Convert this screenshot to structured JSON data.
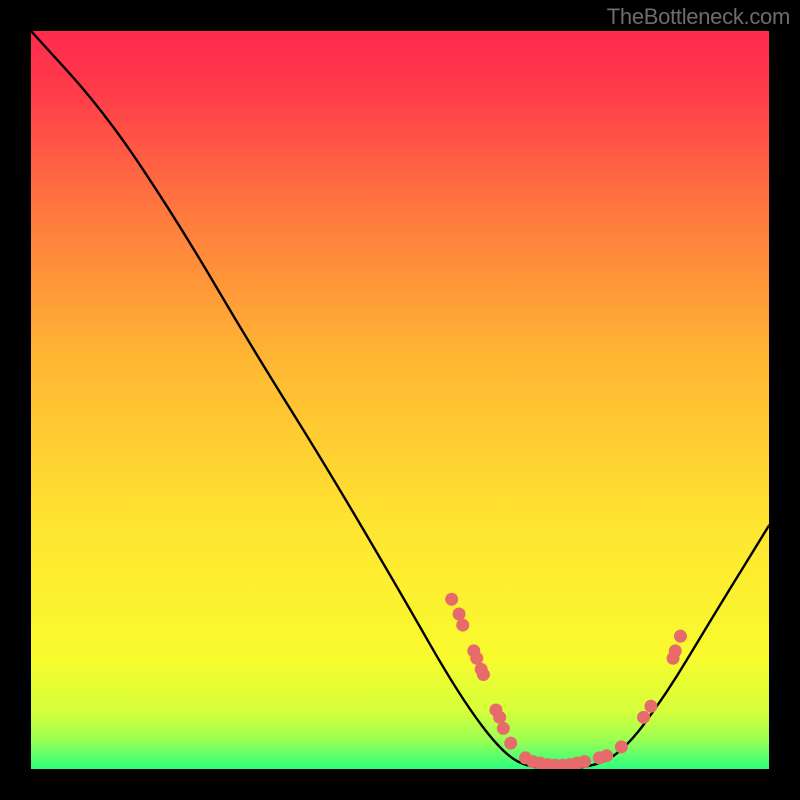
{
  "attribution": "TheBottleneck.com",
  "chart_data": {
    "type": "line",
    "title": "",
    "xlabel": "",
    "ylabel": "",
    "xlim": [
      0,
      100
    ],
    "ylim": [
      0,
      100
    ],
    "background": {
      "gradient_top": "#ff2a4d",
      "gradient_mid": "#ffe631",
      "gradient_bottom": "#2dff7e"
    },
    "curve": [
      {
        "x": 0,
        "y": 100
      },
      {
        "x": 10,
        "y": 89
      },
      {
        "x": 20,
        "y": 74
      },
      {
        "x": 30,
        "y": 57
      },
      {
        "x": 40,
        "y": 41
      },
      {
        "x": 50,
        "y": 24
      },
      {
        "x": 58,
        "y": 10
      },
      {
        "x": 64,
        "y": 2
      },
      {
        "x": 68,
        "y": 0
      },
      {
        "x": 75,
        "y": 0
      },
      {
        "x": 80,
        "y": 2
      },
      {
        "x": 86,
        "y": 10
      },
      {
        "x": 92,
        "y": 20
      },
      {
        "x": 100,
        "y": 33
      }
    ],
    "dots": [
      {
        "x": 57,
        "y": 23
      },
      {
        "x": 58,
        "y": 21
      },
      {
        "x": 58.5,
        "y": 19.5
      },
      {
        "x": 60,
        "y": 16
      },
      {
        "x": 60.4,
        "y": 15
      },
      {
        "x": 61,
        "y": 13.5
      },
      {
        "x": 61.3,
        "y": 12.8
      },
      {
        "x": 63,
        "y": 8
      },
      {
        "x": 63.5,
        "y": 7
      },
      {
        "x": 64,
        "y": 5.5
      },
      {
        "x": 65,
        "y": 3.5
      },
      {
        "x": 67,
        "y": 1.5
      },
      {
        "x": 68,
        "y": 1
      },
      {
        "x": 69,
        "y": 0.8
      },
      {
        "x": 70,
        "y": 0.6
      },
      {
        "x": 71,
        "y": 0.5
      },
      {
        "x": 72,
        "y": 0.5
      },
      {
        "x": 73,
        "y": 0.6
      },
      {
        "x": 74,
        "y": 0.8
      },
      {
        "x": 75,
        "y": 1
      },
      {
        "x": 77,
        "y": 1.5
      },
      {
        "x": 78,
        "y": 1.8
      },
      {
        "x": 80,
        "y": 3
      },
      {
        "x": 83,
        "y": 7
      },
      {
        "x": 84,
        "y": 8.5
      },
      {
        "x": 87,
        "y": 15
      },
      {
        "x": 87.3,
        "y": 16
      },
      {
        "x": 88,
        "y": 18
      }
    ],
    "colors": {
      "curve": "#000000",
      "dots": "#e86b6b"
    }
  }
}
